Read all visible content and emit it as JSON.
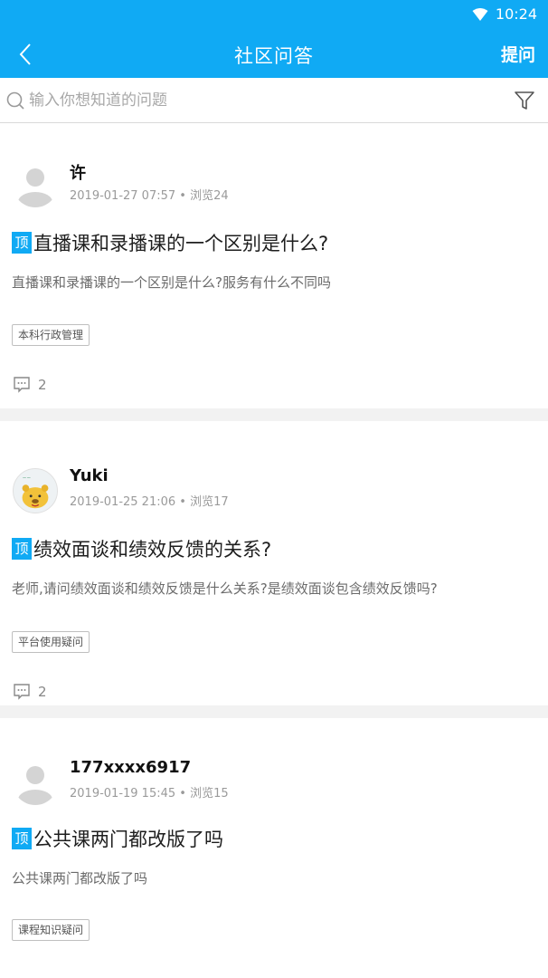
{
  "status": {
    "time": "10:24"
  },
  "header": {
    "title": "社区问答",
    "ask_label": "提问"
  },
  "search": {
    "placeholder": "输入你想知道的问题"
  },
  "posts": [
    {
      "username": "许",
      "date": "2019-01-27 07:57",
      "views": "浏览24",
      "badge": "顶",
      "title": "直播课和录播课的一个区别是什么?",
      "desc": "直播课和录播课的一个区别是什么?服务有什么不同吗",
      "tag": "本科行政管理",
      "comment_count": "2",
      "avatar": "default-avatar"
    },
    {
      "username": "Yuki",
      "date": "2019-01-25 21:06",
      "views": "浏览17",
      "badge": "顶",
      "title": "绩效面谈和绩效反馈的关系?",
      "desc": "老师,请问绩效面谈和绩效反馈是什么关系?是绩效面谈包含绩效反馈吗?",
      "tag": "平台使用疑问",
      "comment_count": "2",
      "avatar": "pooh-avatar"
    },
    {
      "username": "177xxxx6917",
      "date": "2019-01-19 15:45",
      "views": "浏览15",
      "badge": "顶",
      "title": "公共课两门都改版了吗",
      "desc": "公共课两门都改版了吗",
      "tag": "课程知识疑问",
      "comment_count": "",
      "avatar": "default-avatar"
    }
  ],
  "colors": {
    "accent": "#10aaf4",
    "divider": "#f2f2f2"
  }
}
